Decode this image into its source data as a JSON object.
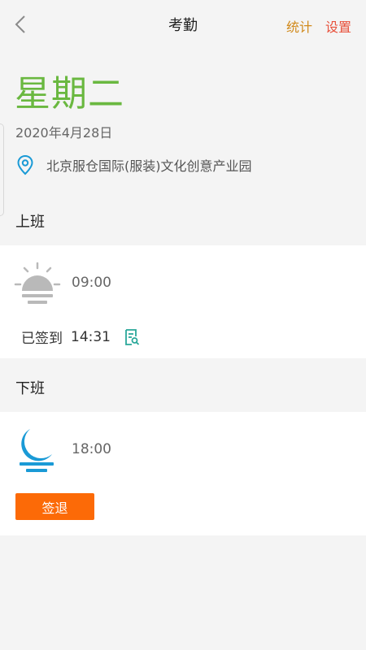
{
  "header": {
    "title": "考勤",
    "stats_label": "统计",
    "settings_label": "设置"
  },
  "day": {
    "weekday": "星期二",
    "date": "2020年4月28日",
    "location": "北京服仓国际(服装)文化创意产业园"
  },
  "on_duty": {
    "label": "上班",
    "time": "09:00",
    "status_label": "已签到",
    "checkin_time": "14:31"
  },
  "off_duty": {
    "label": "下班",
    "time": "18:00",
    "signout_label": "签退"
  },
  "colors": {
    "weekday": "#6ab840",
    "stats": "#d18a1c",
    "settings": "#e8503a",
    "signout_button": "#fc6a07",
    "moon": "#1a9ad6",
    "sun": "#b9b9b9",
    "location_pin": "#1a9ad6",
    "record_icon": "#2aa89a"
  },
  "icons": {
    "back": "chevron-left-icon",
    "location": "location-pin-icon",
    "sunrise": "sunrise-icon",
    "record": "checkin-record-icon",
    "moon": "moon-icon"
  }
}
